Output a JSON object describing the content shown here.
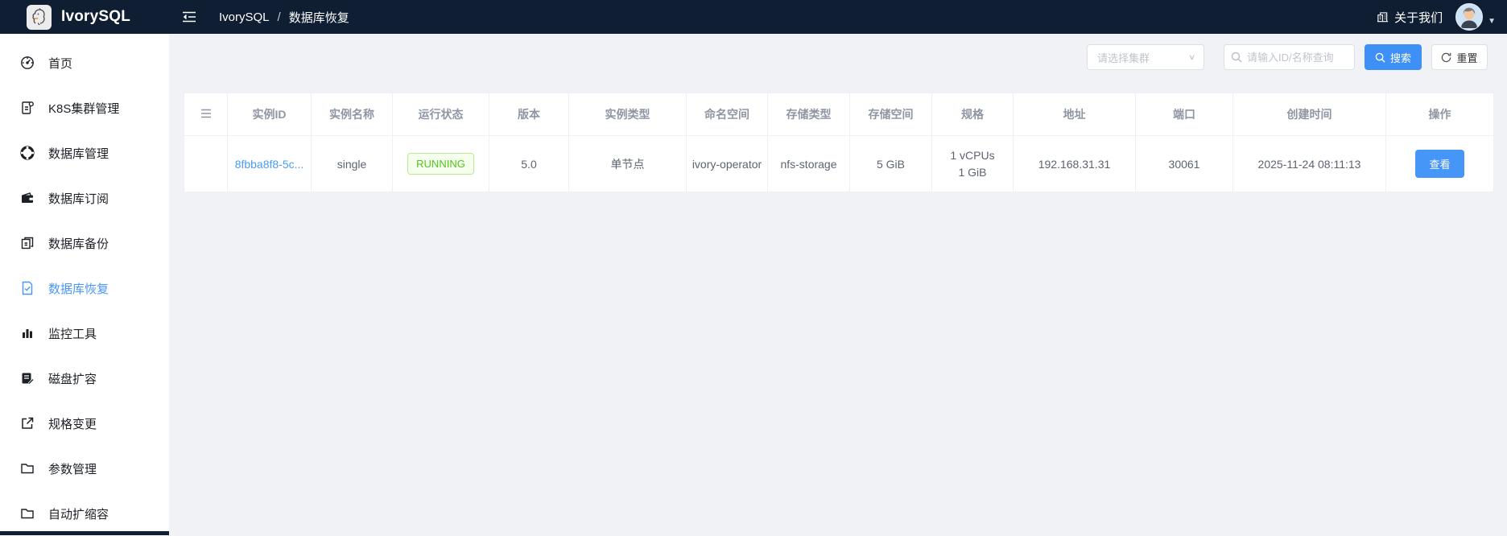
{
  "topbar": {
    "brand": "IvorySQL",
    "breadcrumb": [
      "IvorySQL",
      "数据库恢复"
    ],
    "breadcrumb_separator": "/",
    "about_label": "关于我们"
  },
  "sidebar": {
    "items": [
      {
        "label": "首页",
        "icon": "dashboard-icon",
        "active": false
      },
      {
        "label": "K8S集群管理",
        "icon": "cluster-icon",
        "active": false
      },
      {
        "label": "数据库管理",
        "icon": "database-manage-icon",
        "active": false
      },
      {
        "label": "数据库订阅",
        "icon": "subscription-icon",
        "active": false
      },
      {
        "label": "数据库备份",
        "icon": "backup-copy-icon",
        "active": false
      },
      {
        "label": "数据库恢复",
        "icon": "restore-file-icon",
        "active": true
      },
      {
        "label": "监控工具",
        "icon": "monitor-chart-icon",
        "active": false
      },
      {
        "label": "磁盘扩容",
        "icon": "disk-expand-icon",
        "active": false
      },
      {
        "label": "规格变更",
        "icon": "spec-change-icon",
        "active": false
      },
      {
        "label": "参数管理",
        "icon": "folder-icon",
        "active": false
      },
      {
        "label": "自动扩缩容",
        "icon": "folder-icon",
        "active": false
      }
    ]
  },
  "filters": {
    "cluster_select_placeholder": "请选择集群",
    "search_placeholder": "请输入ID/名称查询",
    "search_button": "搜索",
    "reset_button": "重置"
  },
  "table": {
    "columns": [
      "实例ID",
      "实例名称",
      "运行状态",
      "版本",
      "实例类型",
      "命名空间",
      "存储类型",
      "存储空间",
      "规格",
      "地址",
      "端口",
      "创建时间",
      "操作"
    ],
    "rows": [
      {
        "instance_id": "8fbba8f8-5c...",
        "instance_name": "single",
        "status": "RUNNING",
        "version": "5.0",
        "instance_type": "单节点",
        "namespace": "ivory-operator",
        "storage_type": "nfs-storage",
        "storage_size": "5 GiB",
        "spec_cpu": "1 vCPUs",
        "spec_mem": "1 GiB",
        "address": "192.168.31.31",
        "port": "30061",
        "created_at": "2025-11-24 08:11:13",
        "action": "查看"
      }
    ]
  },
  "colors": {
    "topbar_bg": "#0f1e33",
    "accent_blue": "#3e90f7",
    "active_menu_blue": "#4a96f7",
    "status_green_text": "#52c41a",
    "status_green_bg": "#f6ffed",
    "status_green_border": "#b7eb8f",
    "content_bg": "#f0f2f5"
  }
}
